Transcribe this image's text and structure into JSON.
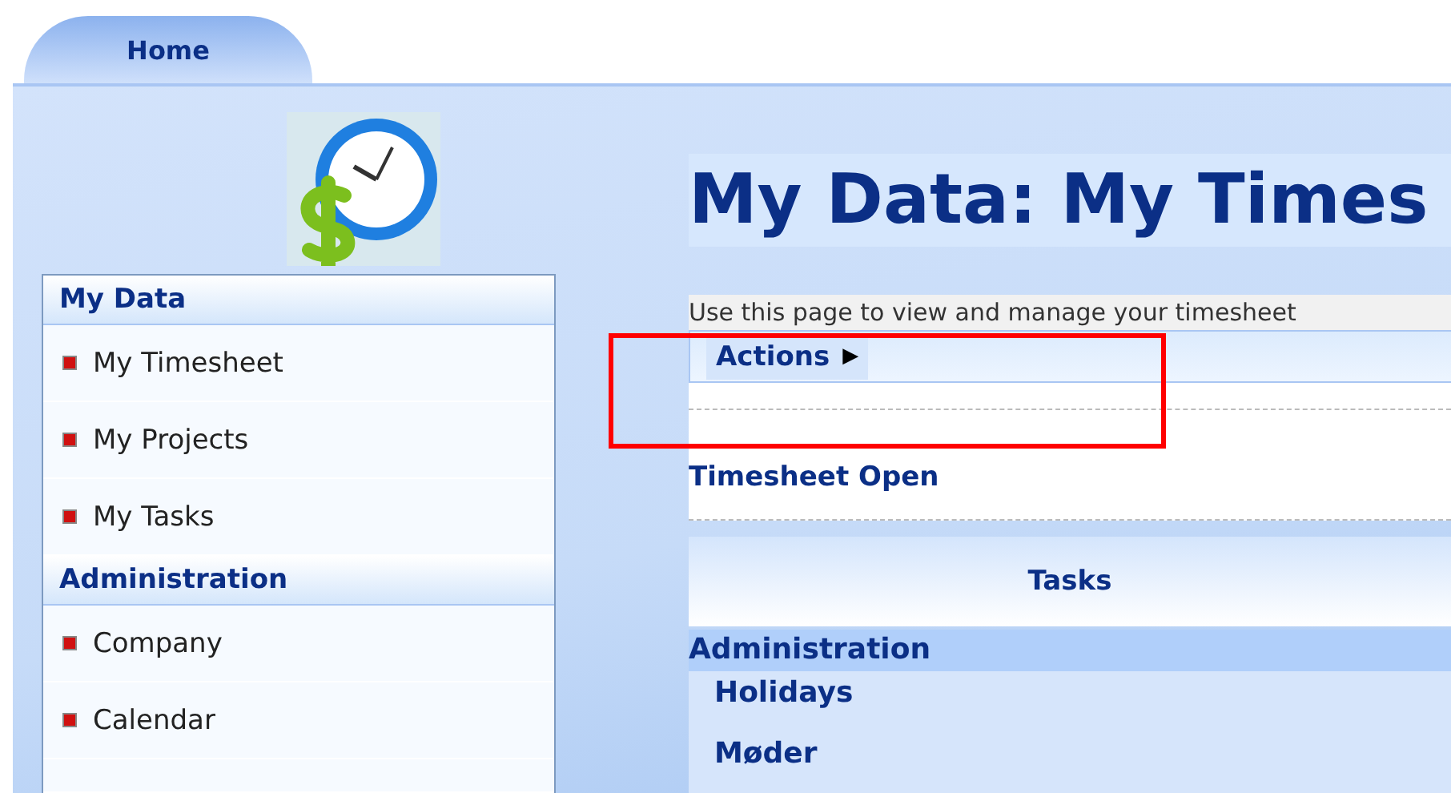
{
  "tabs": [
    {
      "label": "Home",
      "selected": true
    }
  ],
  "sidebar": {
    "sections": [
      {
        "title": "My Data",
        "items": [
          {
            "label": "My Timesheet"
          },
          {
            "label": "My Projects"
          },
          {
            "label": "My Tasks"
          }
        ]
      },
      {
        "title": "Administration",
        "items": [
          {
            "label": "Company"
          },
          {
            "label": "Calendar"
          }
        ]
      }
    ]
  },
  "page": {
    "title": "My Data: My Times",
    "description": "Use this page to view and manage your timesheet",
    "actions_menu": "Actions",
    "actions_arrow": "▶",
    "status": "Timesheet Open",
    "tasks": {
      "heading": "Tasks",
      "groups": [
        {
          "name": "Administration",
          "items": [
            "Holidays",
            "Møder"
          ]
        }
      ]
    }
  },
  "annotation": {
    "kind": "box"
  }
}
